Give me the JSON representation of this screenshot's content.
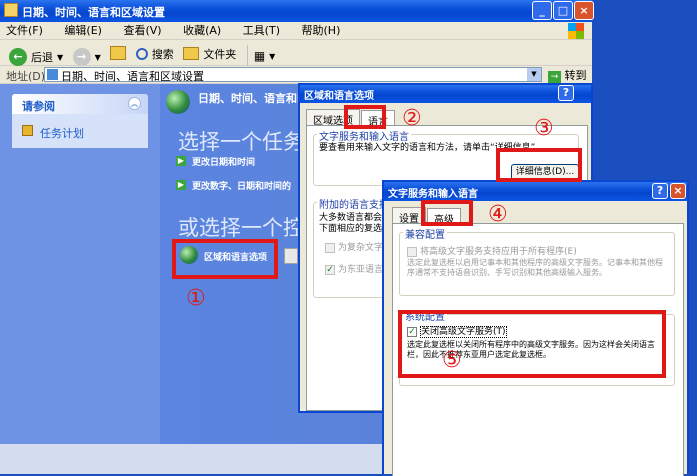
{
  "main_window": {
    "title": "日期、时间、语言和区域设置",
    "menu": [
      "文件(F)",
      "编辑(E)",
      "查看(V)",
      "收藏(A)",
      "工具(T)",
      "帮助(H)"
    ],
    "toolbar": {
      "back": "后退",
      "search": "搜索",
      "folders": "文件夹"
    },
    "address_label": "地址(D)",
    "address_value": "日期、时间、语言和区域设置",
    "go_label": "转到",
    "sidebar": {
      "title": "请参阅",
      "items": [
        "任务计划"
      ]
    },
    "header": "日期、时间、语言和区",
    "pick_task": "选择一个任务",
    "tasks": [
      "更改日期和时间",
      "更改数字、日期和时间的"
    ],
    "pick_icon": "或选择一个控",
    "icons": [
      "区域和语言选项"
    ]
  },
  "region_dialog": {
    "title": "区域和语言选项",
    "tabs": [
      "区域选项",
      "语言"
    ],
    "group1_title": "文字服务和输入语言",
    "group1_text": "要查看用来输入文字的语言和方法，请单击“详细信息”。",
    "details_button": "详细信息(D)...",
    "group2_title": "附加的语言支持",
    "group2_text1": "大多数语言都会在",
    "group2_text2": "下面相应的复选框",
    "checks": [
      "为复杂文字",
      "为东亚语言"
    ]
  },
  "text_dialog": {
    "title": "文字服务和输入语言",
    "tabs": [
      "设置",
      "高级"
    ],
    "compat_title": "兼容配置",
    "compat_check": "将高级文字服务支持应用于所有程序(E)",
    "compat_desc": "选定此复选框以启用记事本和其他程序的高级文字服务。记事本和其他程序通常不支持语音识别、手写识别和其他高级输入服务。",
    "system_title": "系统配置",
    "system_check": "关闭高级文字服务(T)",
    "system_desc": "选定此复选框以关闭所有程序中的高级文字服务。因为这样会关闭语言栏，因此不推荐东亚用户选定此复选框。"
  },
  "annotations": [
    "①",
    "②",
    "③",
    "④",
    "⑤"
  ]
}
